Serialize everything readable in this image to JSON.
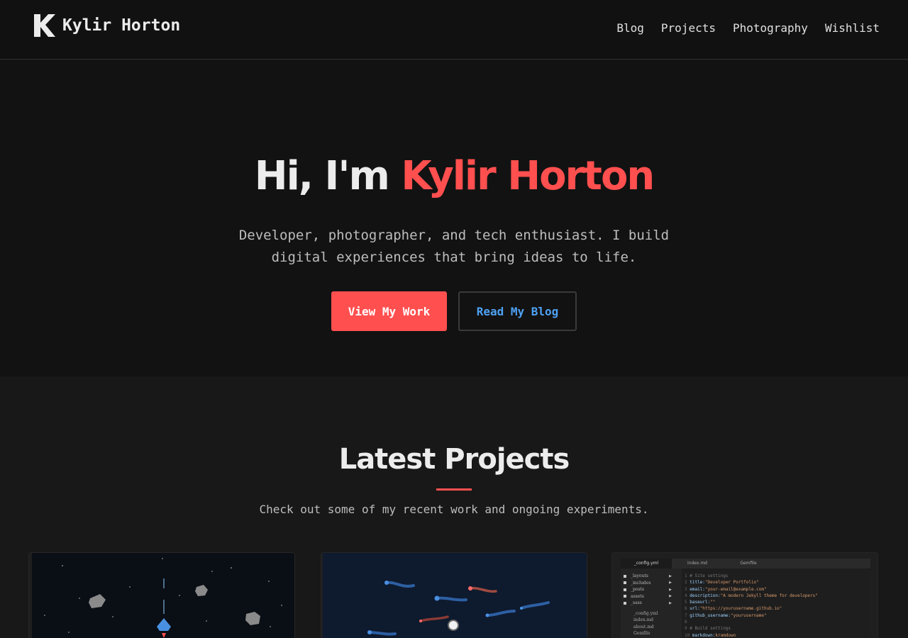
{
  "header": {
    "logo_letter": "K",
    "site_name": "Kylir Horton",
    "nav": [
      "Blog",
      "Projects",
      "Photography",
      "Wishlist"
    ]
  },
  "hero": {
    "greeting": "Hi, I'm ",
    "name": "Kylir Horton",
    "description_line1": "Developer, photographer, and tech enthusiast. I build",
    "description_line2": "digital experiences that bring ideas to life.",
    "primary_button": "View My Work",
    "secondary_button": "Read My Blog"
  },
  "projects": {
    "title": "Latest Projects",
    "subtitle": "Check out some of my recent work and ongoing experiments.",
    "editor": {
      "tabs": [
        "_config.yml",
        "index.md",
        "Gemfile"
      ],
      "folders": [
        "_layouts",
        "_includes",
        "_posts",
        "assets",
        "_sass"
      ],
      "files": [
        "_config.yml",
        "index.md",
        "about.md",
        "Gemfile"
      ],
      "code": [
        {
          "n": "1",
          "comment": "# Site settings"
        },
        {
          "n": "2",
          "key": "title:",
          "val": "\"Developer Portfolio\""
        },
        {
          "n": "3",
          "key": "email:",
          "val": "\"your-email@example.com\""
        },
        {
          "n": "4",
          "key": "description:",
          "val": "\"A modern Jekyll theme for developers\""
        },
        {
          "n": "5",
          "key": "baseurl:",
          "val": "\"\""
        },
        {
          "n": "6",
          "key": "url:",
          "val": "\"https://yourusername.github.io\""
        },
        {
          "n": "7",
          "key": "github_username:",
          "val": "\"yourusername\""
        },
        {
          "n": "8",
          "comment": ""
        },
        {
          "n": "9",
          "comment": "# Build settings"
        },
        {
          "n": "10",
          "key": "markdown:",
          "val": "kramdown"
        }
      ]
    }
  },
  "colors": {
    "accent": "#ff4f4f",
    "link_blue": "#4ea1f3",
    "background": "#181818",
    "hero_background": "#121212",
    "header_background": "#111111"
  }
}
